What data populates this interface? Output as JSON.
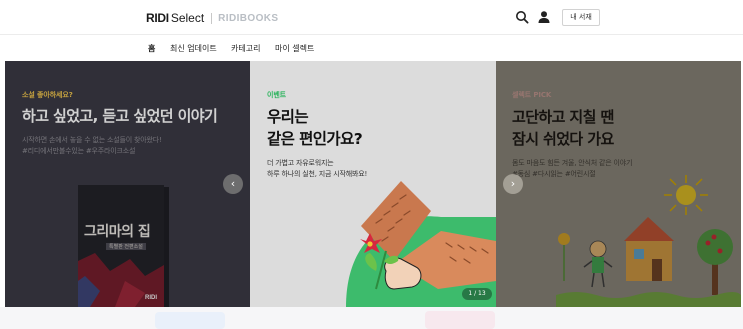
{
  "header": {
    "brand_primary": "RIDI",
    "brand_secondary": "Select",
    "brand_partner": "RIDIBOOKS",
    "mybooks_label": "내 서재"
  },
  "nav": {
    "items": [
      "홈",
      "최신 업데이트",
      "카테고리",
      "마이 셀렉트"
    ],
    "active": "홈"
  },
  "carousel": {
    "slides": [
      {
        "eyebrow": "소설 좋아하세요?",
        "headline": "하고 싶었고, 듣고 싶었던 이야기",
        "desc_line1": "시작하면 손에서 놓을 수 없는 소설들이 찾아왔다!",
        "desc_line2": "#리디에서만볼수있는 #우주라이크소설",
        "book_title": "그리마의 집",
        "book_subtitle": "특별판 전편소설",
        "book_publisher": "RIDI"
      },
      {
        "eyebrow": "이벤트",
        "headline_line1": "우리는",
        "headline_line2": "같은 편인가요?",
        "desc_line1": "더 가볍고 자유로워지는",
        "desc_line2": "하루 하나의 실천, 지금 시작해봐요!"
      },
      {
        "eyebrow": "셀렉트 PICK",
        "headline_line1": "고단하고 지칠 땐",
        "headline_line2": "잠시 쉬었다 가요",
        "desc_line1": "몸도 마음도 힘든 겨울, 안식처 같은 이야기",
        "desc_line2": "#동심 #다시읽는 #어린시절"
      }
    ],
    "pager": "1 / 13",
    "prev_glyph": "‹",
    "next_glyph": "›"
  },
  "colors": {
    "slide1_bg": "#3b3a45",
    "slide2_bg": "#dcdcdc",
    "slide3_bg": "#9a9487",
    "event_green": "#29b35b",
    "novel_yellow": "#f0c54d",
    "pick_pink": "#d8a8a0"
  },
  "icons": [
    "search-icon",
    "user-icon",
    "chevron-left-icon",
    "chevron-right-icon"
  ]
}
